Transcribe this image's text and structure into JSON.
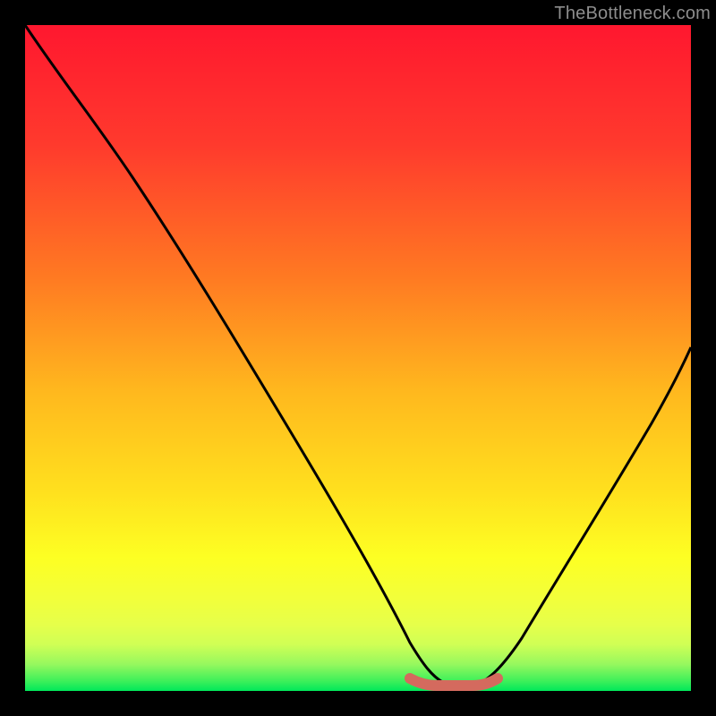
{
  "watermark": "TheBottleneck.com",
  "chart_data": {
    "type": "line",
    "title": "",
    "xlabel": "",
    "ylabel": "",
    "xlim": [
      0,
      100
    ],
    "ylim": [
      0,
      100
    ],
    "series": [
      {
        "name": "bottleneck-curve",
        "x": [
          0,
          5,
          10,
          15,
          20,
          25,
          30,
          35,
          40,
          45,
          50,
          55,
          57,
          60,
          63,
          65,
          70,
          75,
          80,
          85,
          90,
          95,
          100
        ],
        "y": [
          100,
          95,
          89,
          82,
          74,
          66,
          57,
          48,
          39,
          30,
          21,
          12,
          6,
          2,
          1,
          1,
          2,
          6,
          13,
          22,
          33,
          46,
          60
        ]
      },
      {
        "name": "flat-bottom-marker",
        "x": [
          57,
          70
        ],
        "y": [
          1,
          1
        ]
      }
    ],
    "gradient_colors": {
      "top": "#ff172f",
      "mid_upper": "#ff5a2b",
      "mid": "#ffd41f",
      "mid_lower": "#f6ff2b",
      "bottom_band_top": "#e6ff4a",
      "bottom": "#00e85a"
    },
    "marker_color": "#d46a5e"
  }
}
